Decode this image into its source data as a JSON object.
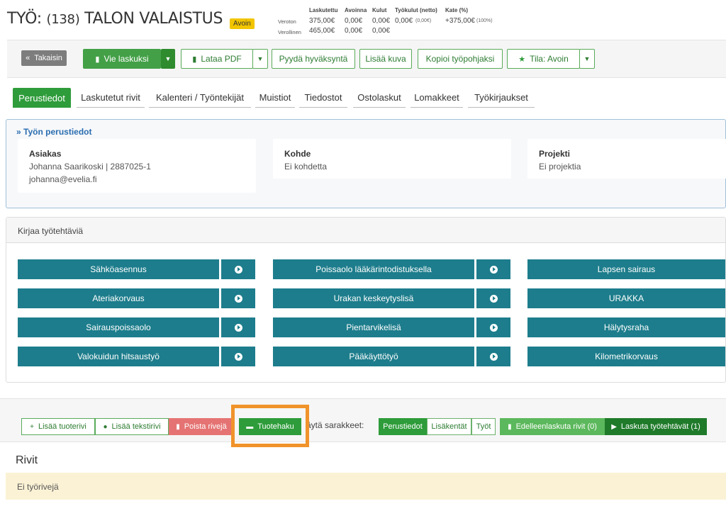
{
  "header": {
    "title_prefix": "TYÖ:",
    "job_number": "(138)",
    "job_name": "TALON VALAISTUS",
    "status_tag": "Avoin",
    "financials": {
      "headers": [
        "Laskutettu",
        "Avoinna",
        "Kulut",
        "Työkulut (netto)",
        "Kate (%)"
      ],
      "rows": [
        {
          "label": "Veroton",
          "laskutettu": "375,00€",
          "avoinna": "0,00€",
          "kulut": "0,00€",
          "tyokulut": "0,00€",
          "tyokulut_sub": "(0,00€)",
          "kate": "+375,00€",
          "kate_sub": "(100%)"
        },
        {
          "label": "Verollinen",
          "laskutettu": "465,00€",
          "avoinna": "0,00€",
          "kulut": "0,00€"
        }
      ]
    }
  },
  "toolbar": {
    "back": "Takaisin",
    "invoice": "Vie laskuksi",
    "pdf": "Lataa PDF",
    "approval": "Pyydä hyväksyntä",
    "add_image": "Lisää kuva",
    "copy_template": "Kopioi työpohjaksi",
    "status": "Tila: Avoin"
  },
  "tabs": [
    "Perustiedot",
    "Laskutetut rivit",
    "Kalenteri / Työntekijät",
    "Muistiot",
    "Tiedostot",
    "Ostolaskut",
    "Lomakkeet",
    "Työkirjaukset"
  ],
  "basic_info": {
    "title": "Työn perustiedot",
    "customer": {
      "label": "Asiakas",
      "line1": "Johanna Saarikoski | 2887025-1",
      "line2": "johanna@evelia.fi"
    },
    "target": {
      "label": "Kohde",
      "value": "Ei kohdetta"
    },
    "project": {
      "label": "Projekti",
      "value": "Ei projektia"
    }
  },
  "tasks": {
    "title": "Kirjaa työtehtäviä",
    "col1": [
      "Sähköasennus",
      "Ateriakorvaus",
      "Sairauspoissaolo",
      "Valokuidun hitsaustyö"
    ],
    "col2": [
      "Poissaolo lääkärintodistuksella",
      "Urakan keskeytyslisä",
      "Pientarvikelisä",
      "Pääkäyttötyö"
    ],
    "col3": [
      "Lapsen sairaus",
      "URAKKA",
      "Hälytysraha",
      "Kilometrikorvaus"
    ]
  },
  "rows_toolbar": {
    "add_product": "Lisää tuoterivi",
    "add_text": "Lisää tekstirivi",
    "delete_row": "Poista rivejä",
    "product_search": "Tuotehaku",
    "show_columns": "äytä sarakkeet:",
    "col_basic": "Perustiedot",
    "col_extra": "Lisäkentät",
    "col_works": "Työt",
    "forward_invoice": "Edelleenlaskuta rivit (0)",
    "invoice_tasks": "Laskuta työtehtävät (1)"
  },
  "rows": {
    "title": "Rivit",
    "empty": "Ei työrivejä"
  }
}
